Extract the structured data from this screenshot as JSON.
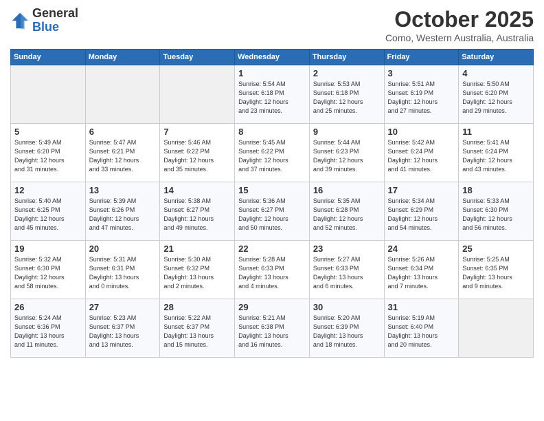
{
  "header": {
    "logo_line1": "General",
    "logo_line2": "Blue",
    "month": "October 2025",
    "location": "Como, Western Australia, Australia"
  },
  "days_of_week": [
    "Sunday",
    "Monday",
    "Tuesday",
    "Wednesday",
    "Thursday",
    "Friday",
    "Saturday"
  ],
  "weeks": [
    [
      {
        "num": "",
        "info": ""
      },
      {
        "num": "",
        "info": ""
      },
      {
        "num": "",
        "info": ""
      },
      {
        "num": "1",
        "info": "Sunrise: 5:54 AM\nSunset: 6:18 PM\nDaylight: 12 hours\nand 23 minutes."
      },
      {
        "num": "2",
        "info": "Sunrise: 5:53 AM\nSunset: 6:18 PM\nDaylight: 12 hours\nand 25 minutes."
      },
      {
        "num": "3",
        "info": "Sunrise: 5:51 AM\nSunset: 6:19 PM\nDaylight: 12 hours\nand 27 minutes."
      },
      {
        "num": "4",
        "info": "Sunrise: 5:50 AM\nSunset: 6:20 PM\nDaylight: 12 hours\nand 29 minutes."
      }
    ],
    [
      {
        "num": "5",
        "info": "Sunrise: 5:49 AM\nSunset: 6:20 PM\nDaylight: 12 hours\nand 31 minutes."
      },
      {
        "num": "6",
        "info": "Sunrise: 5:47 AM\nSunset: 6:21 PM\nDaylight: 12 hours\nand 33 minutes."
      },
      {
        "num": "7",
        "info": "Sunrise: 5:46 AM\nSunset: 6:22 PM\nDaylight: 12 hours\nand 35 minutes."
      },
      {
        "num": "8",
        "info": "Sunrise: 5:45 AM\nSunset: 6:22 PM\nDaylight: 12 hours\nand 37 minutes."
      },
      {
        "num": "9",
        "info": "Sunrise: 5:44 AM\nSunset: 6:23 PM\nDaylight: 12 hours\nand 39 minutes."
      },
      {
        "num": "10",
        "info": "Sunrise: 5:42 AM\nSunset: 6:24 PM\nDaylight: 12 hours\nand 41 minutes."
      },
      {
        "num": "11",
        "info": "Sunrise: 5:41 AM\nSunset: 6:24 PM\nDaylight: 12 hours\nand 43 minutes."
      }
    ],
    [
      {
        "num": "12",
        "info": "Sunrise: 5:40 AM\nSunset: 6:25 PM\nDaylight: 12 hours\nand 45 minutes."
      },
      {
        "num": "13",
        "info": "Sunrise: 5:39 AM\nSunset: 6:26 PM\nDaylight: 12 hours\nand 47 minutes."
      },
      {
        "num": "14",
        "info": "Sunrise: 5:38 AM\nSunset: 6:27 PM\nDaylight: 12 hours\nand 49 minutes."
      },
      {
        "num": "15",
        "info": "Sunrise: 5:36 AM\nSunset: 6:27 PM\nDaylight: 12 hours\nand 50 minutes."
      },
      {
        "num": "16",
        "info": "Sunrise: 5:35 AM\nSunset: 6:28 PM\nDaylight: 12 hours\nand 52 minutes."
      },
      {
        "num": "17",
        "info": "Sunrise: 5:34 AM\nSunset: 6:29 PM\nDaylight: 12 hours\nand 54 minutes."
      },
      {
        "num": "18",
        "info": "Sunrise: 5:33 AM\nSunset: 6:30 PM\nDaylight: 12 hours\nand 56 minutes."
      }
    ],
    [
      {
        "num": "19",
        "info": "Sunrise: 5:32 AM\nSunset: 6:30 PM\nDaylight: 12 hours\nand 58 minutes."
      },
      {
        "num": "20",
        "info": "Sunrise: 5:31 AM\nSunset: 6:31 PM\nDaylight: 13 hours\nand 0 minutes."
      },
      {
        "num": "21",
        "info": "Sunrise: 5:30 AM\nSunset: 6:32 PM\nDaylight: 13 hours\nand 2 minutes."
      },
      {
        "num": "22",
        "info": "Sunrise: 5:28 AM\nSunset: 6:33 PM\nDaylight: 13 hours\nand 4 minutes."
      },
      {
        "num": "23",
        "info": "Sunrise: 5:27 AM\nSunset: 6:33 PM\nDaylight: 13 hours\nand 6 minutes."
      },
      {
        "num": "24",
        "info": "Sunrise: 5:26 AM\nSunset: 6:34 PM\nDaylight: 13 hours\nand 7 minutes."
      },
      {
        "num": "25",
        "info": "Sunrise: 5:25 AM\nSunset: 6:35 PM\nDaylight: 13 hours\nand 9 minutes."
      }
    ],
    [
      {
        "num": "26",
        "info": "Sunrise: 5:24 AM\nSunset: 6:36 PM\nDaylight: 13 hours\nand 11 minutes."
      },
      {
        "num": "27",
        "info": "Sunrise: 5:23 AM\nSunset: 6:37 PM\nDaylight: 13 hours\nand 13 minutes."
      },
      {
        "num": "28",
        "info": "Sunrise: 5:22 AM\nSunset: 6:37 PM\nDaylight: 13 hours\nand 15 minutes."
      },
      {
        "num": "29",
        "info": "Sunrise: 5:21 AM\nSunset: 6:38 PM\nDaylight: 13 hours\nand 16 minutes."
      },
      {
        "num": "30",
        "info": "Sunrise: 5:20 AM\nSunset: 6:39 PM\nDaylight: 13 hours\nand 18 minutes."
      },
      {
        "num": "31",
        "info": "Sunrise: 5:19 AM\nSunset: 6:40 PM\nDaylight: 13 hours\nand 20 minutes."
      },
      {
        "num": "",
        "info": ""
      }
    ]
  ]
}
